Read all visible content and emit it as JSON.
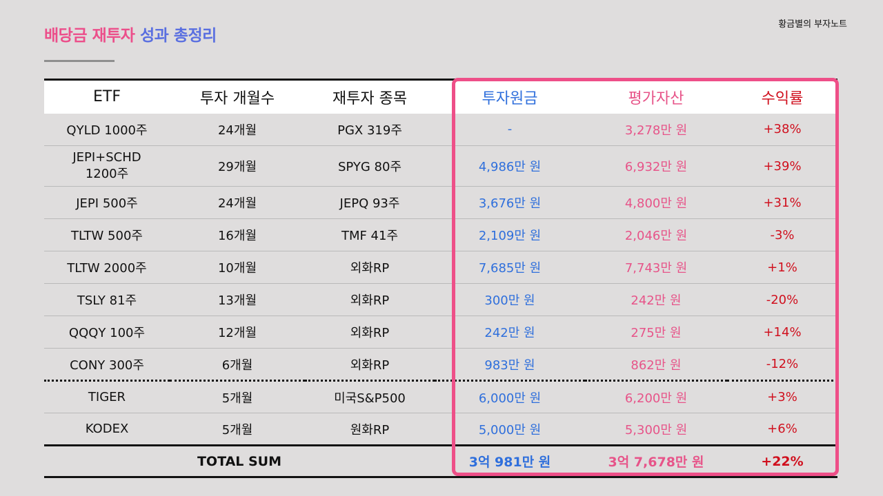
{
  "header": {
    "title_part1": "배당금 재투자",
    "title_part2": "성과 총정리",
    "brand": "황금별의 부자노트"
  },
  "colors": {
    "title_pink": "#ec4e8a",
    "title_blue": "#5a6fe0",
    "invest_blue": "#2f6fdc",
    "value_pink": "#e75489",
    "return_red": "#d0101e",
    "highlight_border": "#ee4f88"
  },
  "table": {
    "columns": [
      "ETF",
      "투자 개월수",
      "재투자 종목",
      "투자원금",
      "평가자산",
      "수익률"
    ],
    "rows": [
      {
        "etf": "QYLD 1000주",
        "months": "24개월",
        "reinvest": "PGX 319주",
        "principal": "-",
        "value": "3,278만 원",
        "return": "+38%"
      },
      {
        "etf": "JEPI+SCHD",
        "etf_line2": "1200주",
        "months": "29개월",
        "reinvest": "SPYG 80주",
        "principal": "4,986만 원",
        "value": "6,932만 원",
        "return": "+39%"
      },
      {
        "etf": "JEPI 500주",
        "months": "24개월",
        "reinvest": "JEPQ 93주",
        "principal": "3,676만 원",
        "value": "4,800만 원",
        "return": "+31%"
      },
      {
        "etf": "TLTW 500주",
        "months": "16개월",
        "reinvest": "TMF 41주",
        "principal": "2,109만 원",
        "value": "2,046만 원",
        "return": "-3%"
      },
      {
        "etf": "TLTW 2000주",
        "months": "10개월",
        "reinvest": "외화RP",
        "principal": "7,685만 원",
        "value": "7,743만 원",
        "return": "+1%"
      },
      {
        "etf": "TSLY 81주",
        "months": "13개월",
        "reinvest": "외화RP",
        "principal": "300만 원",
        "value": "242만 원",
        "return": "-20%"
      },
      {
        "etf": "QQQY 100주",
        "months": "12개월",
        "reinvest": "외화RP",
        "principal": "242만 원",
        "value": "275만 원",
        "return": "+14%"
      },
      {
        "etf": "CONY 300주",
        "months": "6개월",
        "reinvest": "외화RP",
        "principal": "983만 원",
        "value": "862만 원",
        "return": "-12%"
      },
      {
        "etf": "TIGER",
        "months": "5개월",
        "reinvest": "미국S&P500",
        "principal": "6,000만 원",
        "value": "6,200만 원",
        "return": "+3%"
      },
      {
        "etf": "KODEX",
        "months": "5개월",
        "reinvest": "원화RP",
        "principal": "5,000만 원",
        "value": "5,300만 원",
        "return": "+6%"
      }
    ],
    "total": {
      "label": "TOTAL SUM",
      "principal": "3억 981만 원",
      "value": "3억 7,678만 원",
      "return": "+22%"
    }
  }
}
